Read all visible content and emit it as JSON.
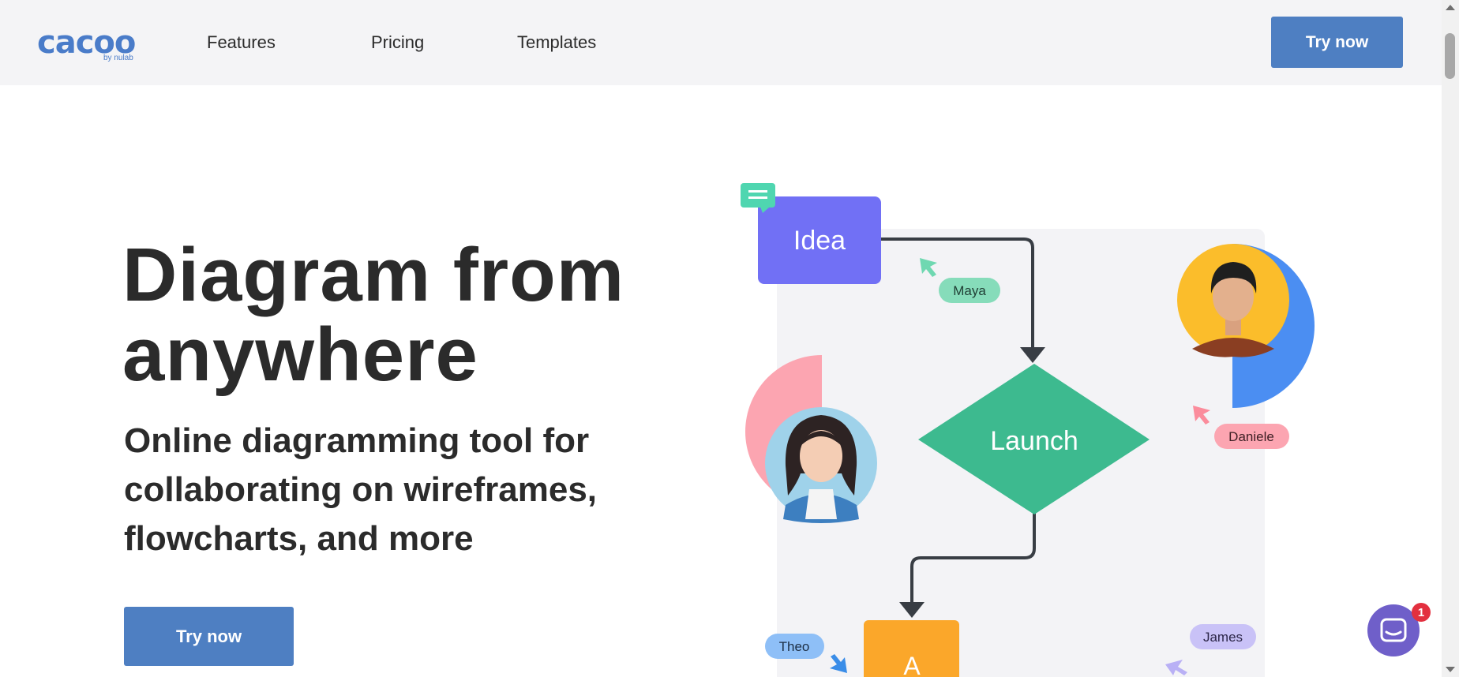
{
  "header": {
    "logo": {
      "name": "cacoo",
      "sub": "by nulab"
    },
    "nav": [
      {
        "label": "Features"
      },
      {
        "label": "Pricing"
      },
      {
        "label": "Templates"
      }
    ],
    "cta": "Try now"
  },
  "hero": {
    "title_lines": [
      "Diagram from",
      "anywhere"
    ],
    "subtitle_lines": [
      "Online diagramming tool for",
      "collaborating on wireframes,",
      "flowcharts, and more"
    ],
    "cta": "Try now"
  },
  "diagram": {
    "nodes": {
      "idea": "Idea",
      "launch": "Launch",
      "a": "A"
    },
    "collaborators": {
      "maya": "Maya",
      "daniele": "Daniele",
      "theo": "Theo",
      "james": "James"
    }
  },
  "chat": {
    "badge_count": "1"
  },
  "colors": {
    "brand_blue": "#4e7fc2",
    "idea_purple": "#7170f5",
    "launch_green": "#3dba8f",
    "node_orange": "#fba72a",
    "maya_tag": "#86dcba",
    "daniele_tag": "#fca5b1",
    "theo_tag": "#8ebff7",
    "james_tag": "#c9c2f7",
    "chat_purple": "#6f5fc9"
  }
}
